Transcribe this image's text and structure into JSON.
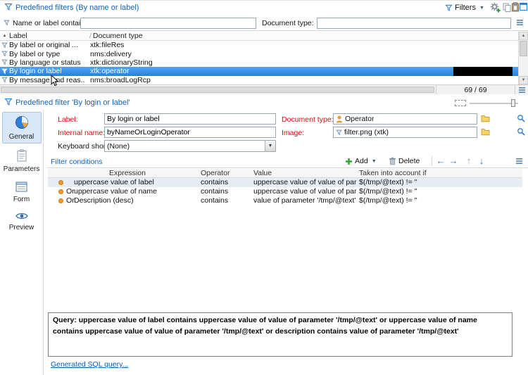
{
  "colors": {
    "accent": "#1464b4",
    "selection": "#2a7fd9",
    "required": "#cc1111",
    "link": "#0b5cad",
    "row_dot": "#f59a23"
  },
  "icons": {
    "caret_down": "▼",
    "sort_asc": "▲",
    "header_separator": "/",
    "arrow_left": "←",
    "arrow_right": "→",
    "arrow_up": "↑",
    "arrow_down": "↓",
    "scroll_up": "▲",
    "scroll_down": "▼"
  },
  "top": {
    "title": "Predefined filters (By name or label)",
    "toolbar": {
      "filters_label": "Filters"
    },
    "search": {
      "name_label": "Name or label contains:",
      "doctype_label": "Document type:"
    },
    "list": {
      "columns": {
        "label": "Label",
        "doctype": "Document type"
      },
      "rows": [
        {
          "label": "By label or original ...",
          "doctype": "xtk:fileRes"
        },
        {
          "label": "By label or type",
          "doctype": "nms:delivery"
        },
        {
          "label": "By language or status",
          "doctype": "xtk:dictionaryString"
        },
        {
          "label": "By login or label",
          "doctype": "xtk:operator"
        },
        {
          "label": "By message and reas..",
          "doctype": "nms:broadLogRcp"
        }
      ],
      "count": "69 / 69"
    }
  },
  "detail": {
    "title": "Predefined filter 'By login or label'",
    "tabs": [
      {
        "label": "General"
      },
      {
        "label": "Parameters"
      },
      {
        "label": "Form"
      },
      {
        "label": "Preview"
      }
    ],
    "fields": {
      "label_caption": "Label:",
      "label_value": "By login or label",
      "internal_caption": "Internal name:",
      "internal_value": "byNameOrLoginOperator",
      "doctype_caption": "Document type:",
      "doctype_value": "Operator",
      "image_caption": "Image:",
      "image_value": "filter.png (xtk)",
      "shortcut_caption": "Keyboard shortcut:",
      "shortcut_value": "(None)"
    },
    "conditions": {
      "section_label": "Filter conditions",
      "add_label": "Add",
      "delete_label": "Delete",
      "columns": [
        "Expression",
        "Operator",
        "Value",
        "Taken into account if"
      ],
      "rows": [
        {
          "prefix": "",
          "expression": "uppercase value of label",
          "operator": "contains",
          "value": "uppercase value of value of param...",
          "taken": "$(/tmp/@text) != ''"
        },
        {
          "prefix": "Or",
          "expression": "uppercase value of name",
          "operator": "contains",
          "value": "uppercase value of value of param...",
          "taken": "$(/tmp/@text) != ''"
        },
        {
          "prefix": "Or",
          "expression": "Description (desc)",
          "operator": "contains",
          "value": "value of parameter '/tmp/@text'",
          "taken": "$(/tmp/@text) != ''"
        }
      ]
    },
    "query_text": "Query: uppercase value of label contains uppercase value of value of parameter '/tmp/@text' or uppercase value of name contains uppercase value of value of parameter '/tmp/@text' or description contains value of parameter '/tmp/@text'",
    "sql_link": "Generated SQL query..."
  }
}
